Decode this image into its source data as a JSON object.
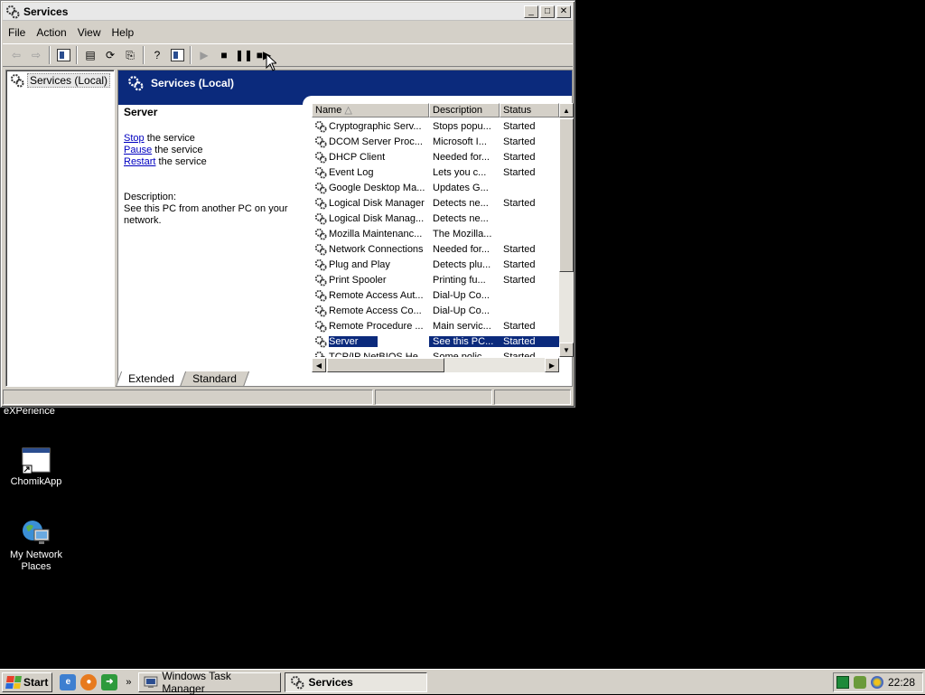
{
  "window": {
    "title": "Services",
    "controls": {
      "minimize": "_",
      "maximize": "□",
      "close": "✕"
    }
  },
  "menu": {
    "file": "File",
    "action": "Action",
    "view": "View",
    "help": "Help"
  },
  "toolbar": {
    "icons": [
      "back-icon",
      "forward-icon",
      "show-hide-tree-icon",
      "properties-icon",
      "refresh-icon",
      "export-list-icon",
      "help-icon",
      "show-hide-action-pane-icon",
      "start-service-icon",
      "stop-service-icon",
      "pause-service-icon",
      "restart-service-icon"
    ]
  },
  "tree": {
    "root_label": "Services (Local)"
  },
  "pane": {
    "header": "Services (Local)",
    "selected_service": "Server",
    "stop_link": "Stop",
    "stop_rest": " the service",
    "pause_link": "Pause",
    "pause_rest": " the service",
    "restart_link": "Restart",
    "restart_rest": " the service",
    "description_label": "Description:",
    "description_text": "See this PC from another PC on your network."
  },
  "list": {
    "columns": [
      "Name",
      "Description",
      "Status"
    ],
    "rows": [
      {
        "name": "Cryptographic Serv...",
        "desc": "Stops popu...",
        "status": "Started"
      },
      {
        "name": "DCOM Server Proc...",
        "desc": "Microsoft I...",
        "status": "Started"
      },
      {
        "name": "DHCP Client",
        "desc": "Needed for...",
        "status": "Started"
      },
      {
        "name": "Event Log",
        "desc": "Lets you c...",
        "status": "Started"
      },
      {
        "name": "Google Desktop Ma...",
        "desc": "Updates G...",
        "status": ""
      },
      {
        "name": "Logical Disk Manager",
        "desc": "Detects ne...",
        "status": "Started"
      },
      {
        "name": "Logical Disk Manag...",
        "desc": "Detects ne...",
        "status": ""
      },
      {
        "name": "Mozilla Maintenanc...",
        "desc": "The Mozilla...",
        "status": ""
      },
      {
        "name": "Network Connections",
        "desc": "Needed for...",
        "status": "Started"
      },
      {
        "name": "Plug and Play",
        "desc": "Detects plu...",
        "status": "Started"
      },
      {
        "name": "Print Spooler",
        "desc": "Printing fu...",
        "status": "Started"
      },
      {
        "name": "Remote Access Aut...",
        "desc": "Dial-Up Co...",
        "status": ""
      },
      {
        "name": "Remote Access Co...",
        "desc": "Dial-Up Co...",
        "status": ""
      },
      {
        "name": "Remote Procedure ...",
        "desc": "Main servic...",
        "status": "Started"
      },
      {
        "name": "Server",
        "desc": "See this PC...",
        "status": "Started",
        "selected": true
      },
      {
        "name": "TCP/IP NetBIOS He...",
        "desc": "Some polic...",
        "status": "Started"
      }
    ]
  },
  "tabs": [
    "Extended",
    "Standard"
  ],
  "desktop": {
    "partial_label": "eXPerience",
    "icons": [
      {
        "label": "ChomikApp",
        "icon": "app-shortcut-icon"
      },
      {
        "label": "My Network Places",
        "icon": "network-places-icon"
      }
    ]
  },
  "taskbar": {
    "start": "Start",
    "quick_launch": [
      "internet-explorer-icon",
      "firefox-icon",
      "green-arrow-icon"
    ],
    "overflow": "»",
    "tasks": [
      {
        "label": "Windows Task Manager",
        "active": false
      },
      {
        "label": "Services",
        "active": true
      }
    ],
    "clock": "22:28"
  },
  "colors": {
    "selection": "#0b2a7c",
    "header_band": "#0b2a7c",
    "link": "#0000c0",
    "chrome": "#d4d0c8"
  }
}
